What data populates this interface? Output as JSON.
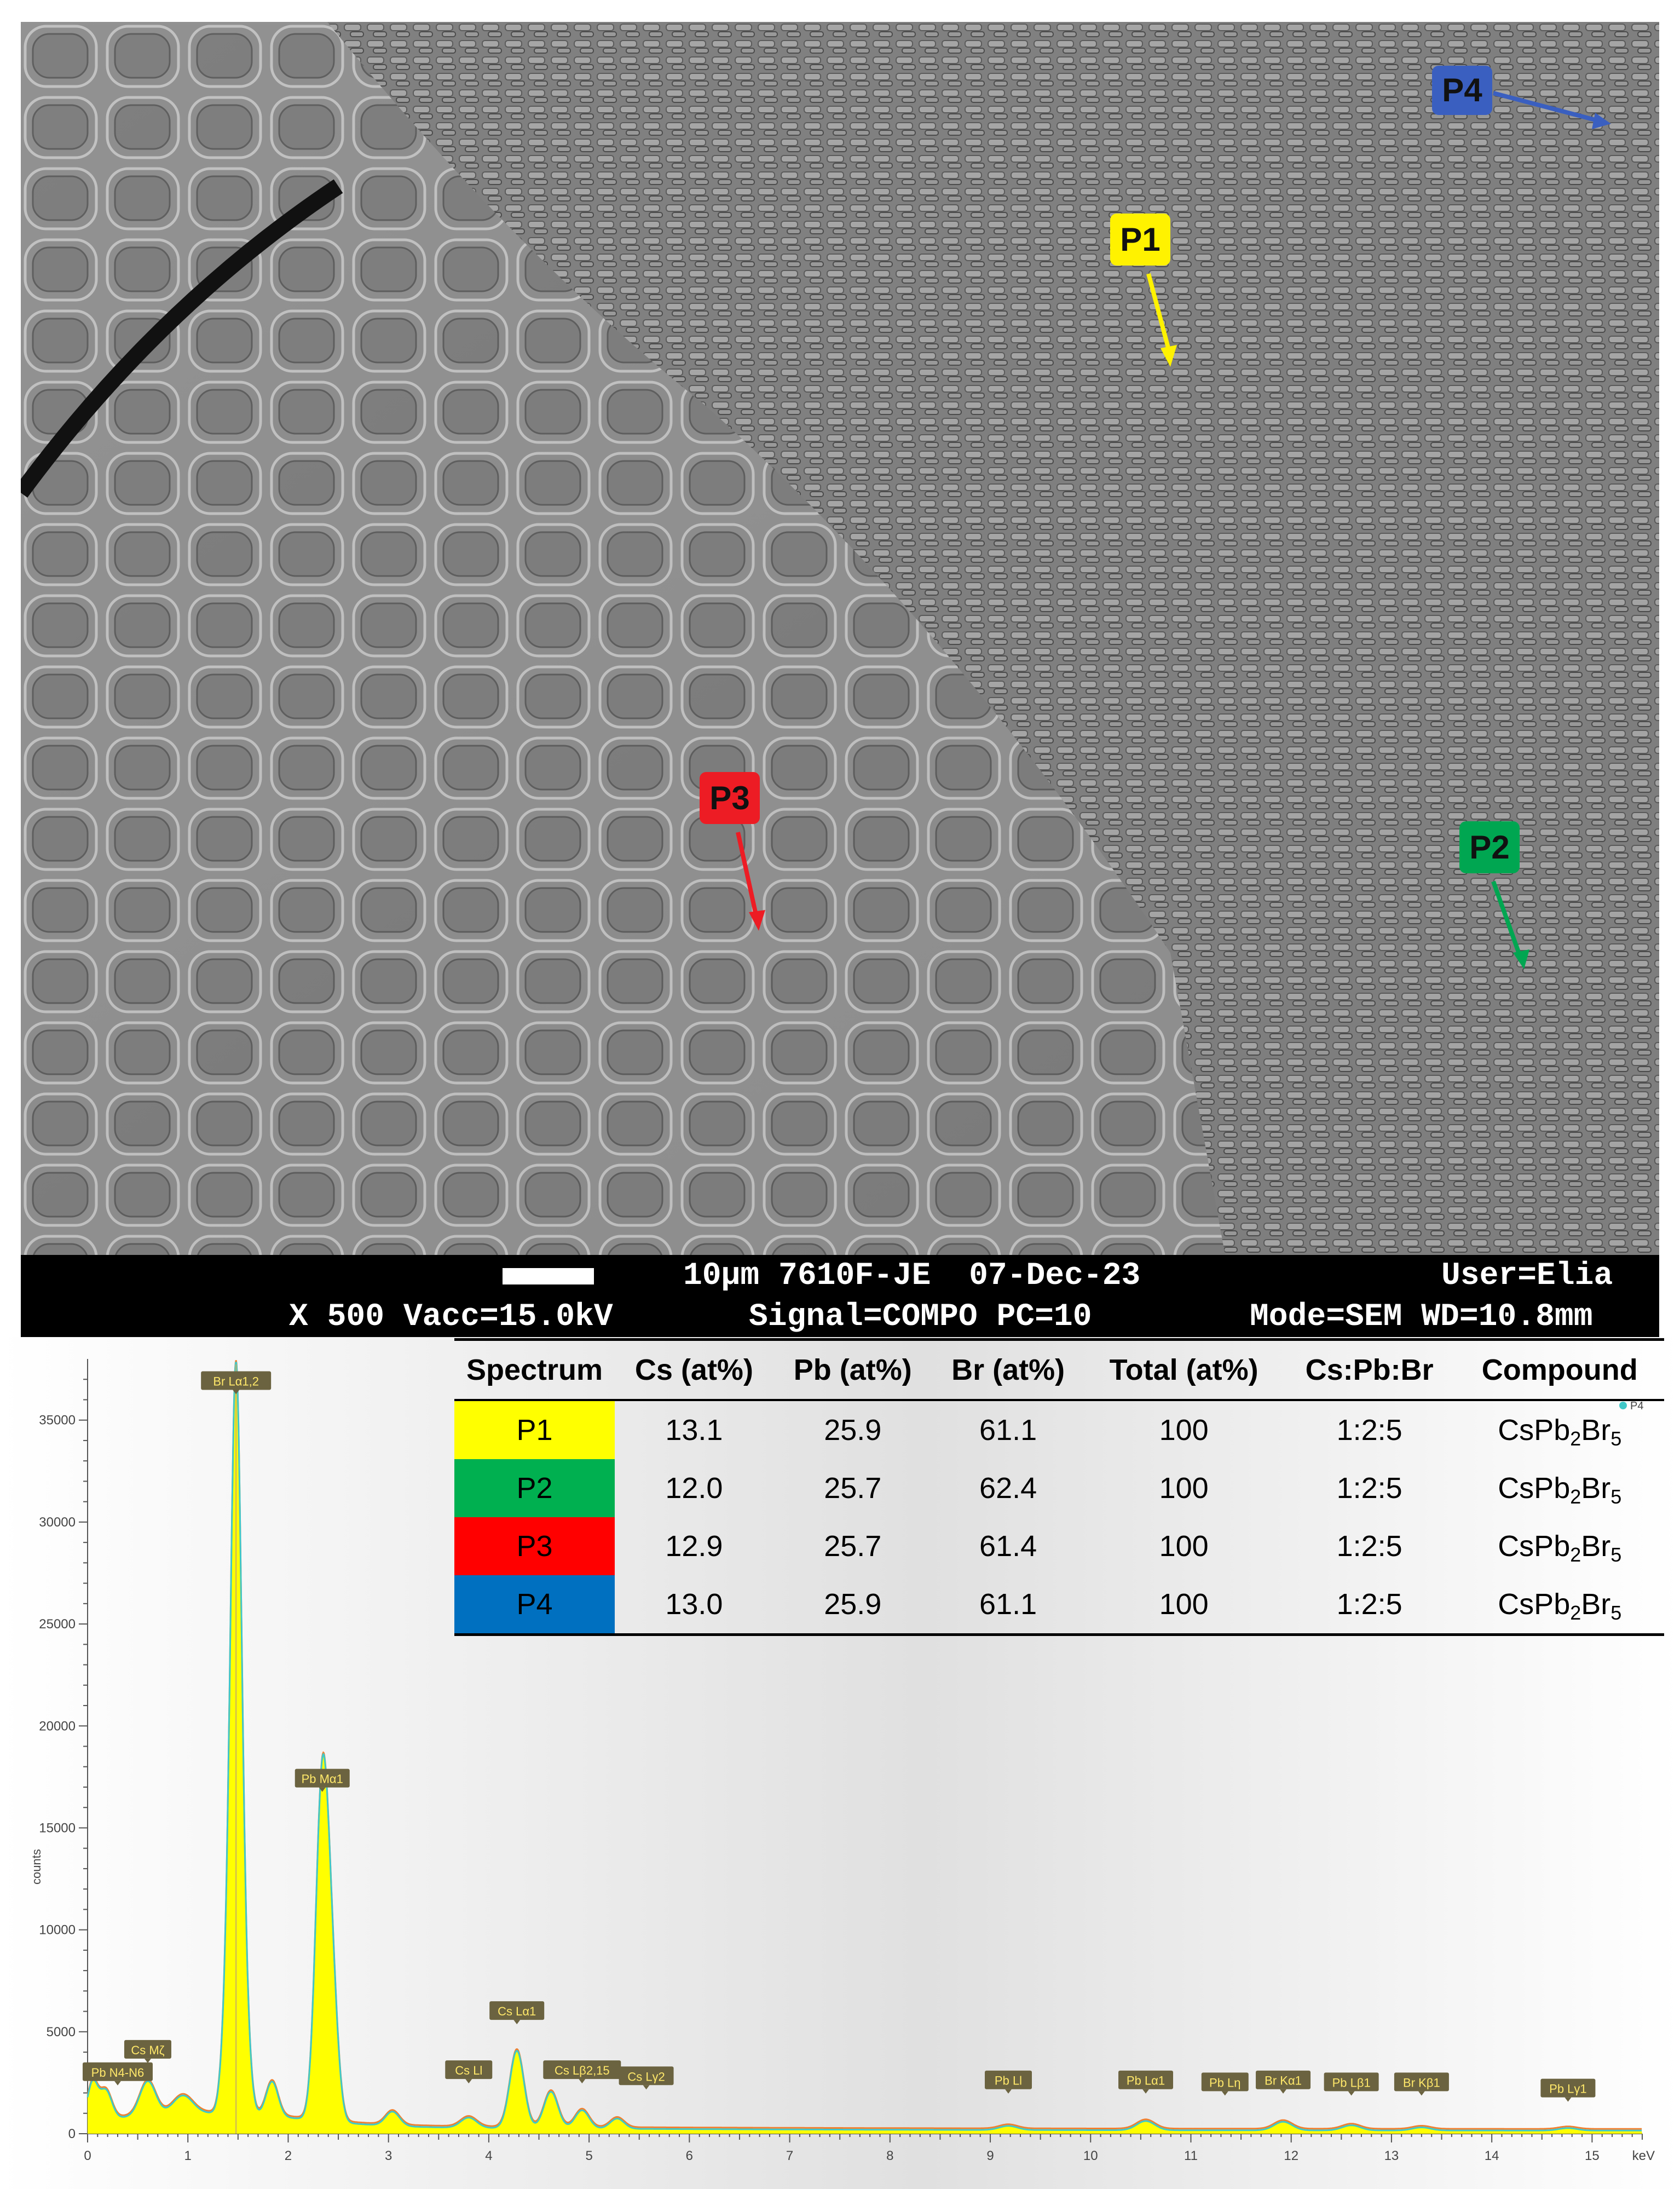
{
  "sem_image": {
    "point_labels": [
      {
        "label": "P1",
        "color": "#fff200"
      },
      {
        "label": "P2",
        "color": "#00a651"
      },
      {
        "label": "P3",
        "color": "#ed1c24"
      },
      {
        "label": "P4",
        "color": "#3a5fc0"
      }
    ],
    "info": {
      "line1_a": "10µm 7610F-JE  07-Dec-23",
      "line1_b": "User=Elia",
      "line2_a": "X 500 Vacc=15.0kV",
      "line2_b": "Signal=COMPO PC=10",
      "line2_c": "Mode=SEM WD=10.8mm"
    }
  },
  "table": {
    "headers": [
      "Spectrum",
      "Cs (at%)",
      "Pb (at%)",
      "Br (at%)",
      "Total (at%)",
      "Cs:Pb:Br",
      "Compound"
    ],
    "rows": [
      {
        "spectrum": "P1",
        "color": "#ffff00",
        "cs": "13.1",
        "pb": "25.9",
        "br": "61.1",
        "total": "100",
        "ratio": "1:2:5",
        "compound": "CsPb",
        "sub1": "2",
        "mid": "Br",
        "sub2": "5"
      },
      {
        "spectrum": "P2",
        "color": "#00b050",
        "cs": "12.0",
        "pb": "25.7",
        "br": "62.4",
        "total": "100",
        "ratio": "1:2:5",
        "compound": "CsPb",
        "sub1": "2",
        "mid": "Br",
        "sub2": "5"
      },
      {
        "spectrum": "P3",
        "color": "#ff0000",
        "cs": "12.9",
        "pb": "25.7",
        "br": "61.4",
        "total": "100",
        "ratio": "1:2:5",
        "compound": "CsPb",
        "sub1": "2",
        "mid": "Br",
        "sub2": "5"
      },
      {
        "spectrum": "P4",
        "color": "#0070c0",
        "cs": "13.0",
        "pb": "25.9",
        "br": "61.1",
        "total": "100",
        "ratio": "1:2:5",
        "compound": "CsPb",
        "sub1": "2",
        "mid": "Br",
        "sub2": "5"
      }
    ]
  },
  "chart_data": {
    "type": "area",
    "xlabel": "keV",
    "ylabel": "counts",
    "xlim": [
      0,
      15.5
    ],
    "ylim": [
      0,
      38000
    ],
    "x_ticks": [
      "0",
      "1",
      "2",
      "3",
      "4",
      "5",
      "6",
      "7",
      "8",
      "9",
      "10",
      "11",
      "12",
      "13",
      "14",
      "15"
    ],
    "y_ticks": [
      "0",
      "5000",
      "10000",
      "15000",
      "20000",
      "25000",
      "30000",
      "35000"
    ],
    "legend": [
      "P4"
    ],
    "series_colors": {
      "fill": "#ffff00",
      "line": "#40c8c8",
      "line2": "#f08030"
    },
    "background": 350,
    "peaks": [
      {
        "x": 0.05,
        "y": 1800,
        "w": 0.05
      },
      {
        "x": 0.18,
        "y": 1400,
        "w": 0.06
      },
      {
        "x": 0.6,
        "y": 1700,
        "w": 0.08
      },
      {
        "x": 0.95,
        "y": 900,
        "w": 0.1
      },
      {
        "x": 1.38,
        "y": 3500,
        "w": 0.05
      },
      {
        "x": 1.48,
        "y": 36000,
        "w": 0.055
      },
      {
        "x": 1.58,
        "y": 3000,
        "w": 0.05
      },
      {
        "x": 1.84,
        "y": 1700,
        "w": 0.06
      },
      {
        "x": 2.34,
        "y": 16500,
        "w": 0.065
      },
      {
        "x": 2.44,
        "y": 5200,
        "w": 0.06
      },
      {
        "x": 3.04,
        "y": 700,
        "w": 0.07
      },
      {
        "x": 3.8,
        "y": 500,
        "w": 0.08
      },
      {
        "x": 4.28,
        "y": 3800,
        "w": 0.07
      },
      {
        "x": 4.62,
        "y": 1800,
        "w": 0.07
      },
      {
        "x": 4.93,
        "y": 900,
        "w": 0.07
      },
      {
        "x": 5.28,
        "y": 500,
        "w": 0.07
      },
      {
        "x": 9.18,
        "y": 200,
        "w": 0.09
      },
      {
        "x": 10.55,
        "y": 450,
        "w": 0.09
      },
      {
        "x": 11.92,
        "y": 420,
        "w": 0.09
      },
      {
        "x": 12.6,
        "y": 250,
        "w": 0.09
      },
      {
        "x": 13.3,
        "y": 150,
        "w": 0.09
      },
      {
        "x": 14.76,
        "y": 120,
        "w": 0.09
      }
    ],
    "annotations": [
      {
        "text": "Br Lα1,2",
        "x": 1.48,
        "y": 36000
      },
      {
        "text": "Pb Mα1",
        "x": 2.34,
        "y": 16500
      },
      {
        "text": "Pb N4-N6",
        "x": 0.3,
        "y": 2100
      },
      {
        "text": "Cs Mζ",
        "x": 0.6,
        "y": 3200
      },
      {
        "text": "Cs Ll",
        "x": 3.8,
        "y": 2200
      },
      {
        "text": "Cs Lα1",
        "x": 4.28,
        "y": 5100
      },
      {
        "text": "Cs Lβ2,15",
        "x": 4.93,
        "y": 2200
      },
      {
        "text": "Cs Lγ2",
        "x": 5.57,
        "y": 1900
      },
      {
        "text": "Pb Ll",
        "x": 9.18,
        "y": 1700
      },
      {
        "text": "Pb Lα1",
        "x": 10.55,
        "y": 1700
      },
      {
        "text": "Pb Lη",
        "x": 11.34,
        "y": 1600
      },
      {
        "text": "Br Kα1",
        "x": 11.92,
        "y": 1700
      },
      {
        "text": "Pb Lβ1",
        "x": 12.6,
        "y": 1600
      },
      {
        "text": "Br Kβ1",
        "x": 13.3,
        "y": 1600
      },
      {
        "text": "Pb Lγ1",
        "x": 14.76,
        "y": 1300
      }
    ]
  }
}
